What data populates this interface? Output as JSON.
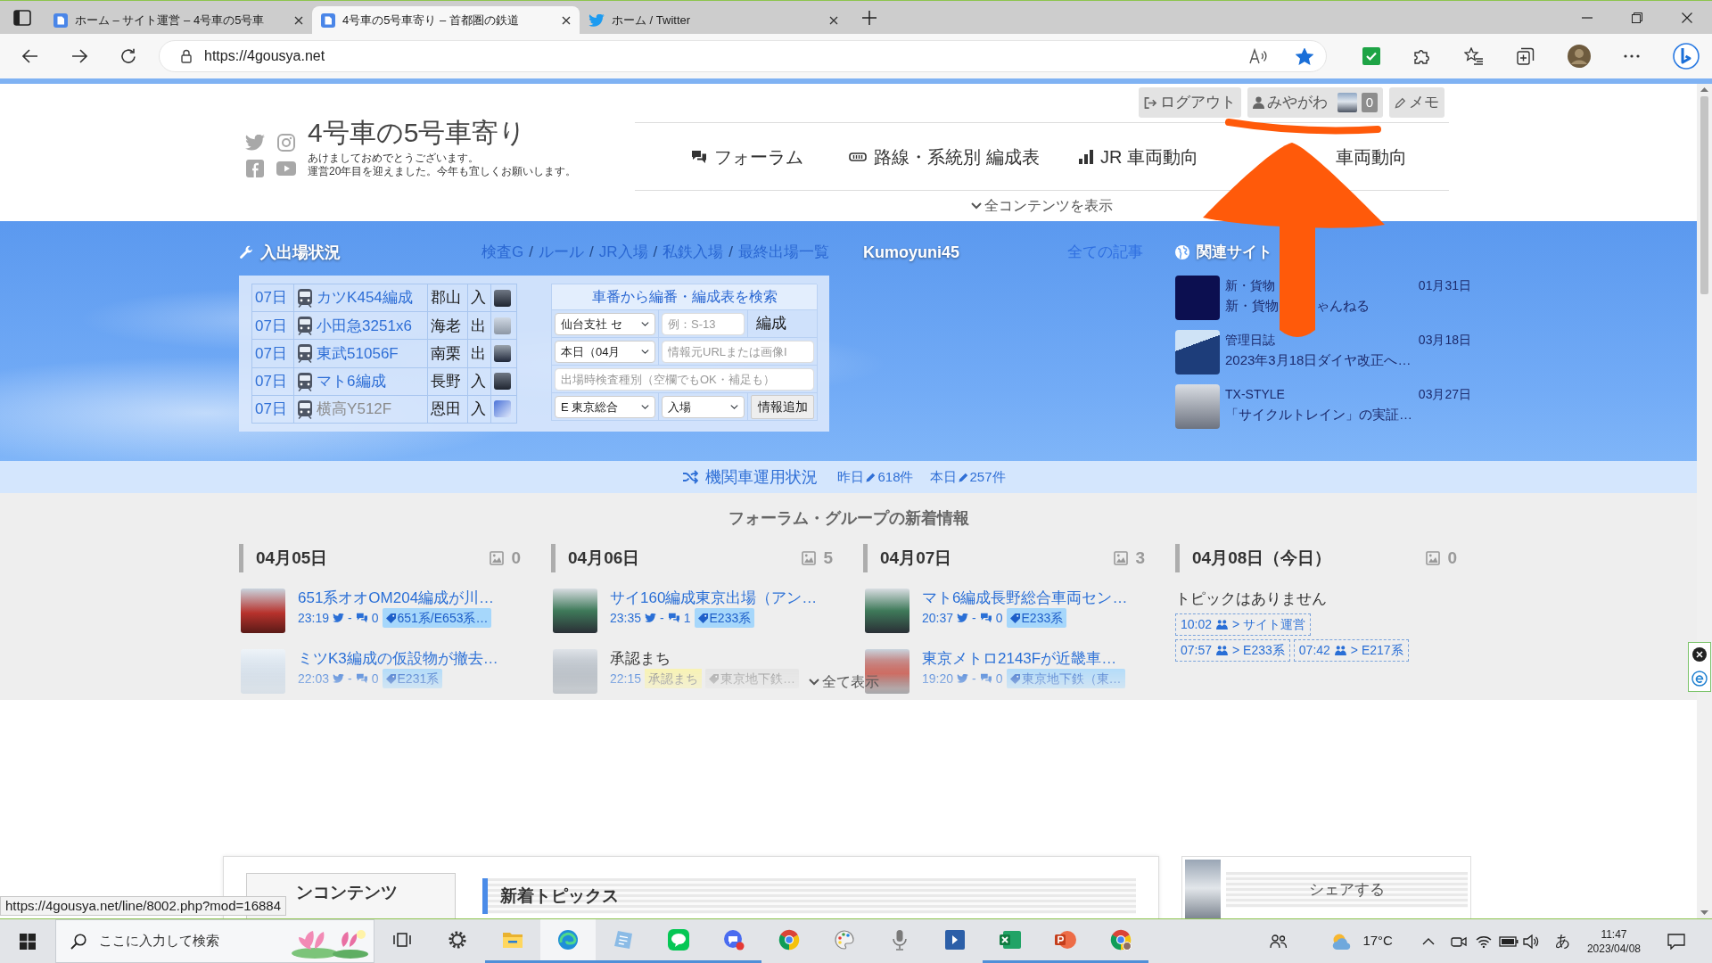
{
  "browser": {
    "tabs": [
      {
        "kind": "site",
        "title": "ホーム – サイト運営 – 4号車の5号車",
        "selected": false
      },
      {
        "kind": "site",
        "title": "4号車の5号車寄り – 首都圏の鉄道",
        "selected": true
      },
      {
        "kind": "twitter",
        "title": "ホーム / Twitter",
        "selected": false
      }
    ],
    "url": "https://4gousya.net",
    "bookmarked": true
  },
  "header": {
    "site_title": "4号車の5号車寄り",
    "tagline": [
      "あけましておめでとうございます。",
      "運営20年目を迎えました。今年も宜しくお願いします。"
    ],
    "account_buttons": [
      {
        "kind": "logout",
        "label": "ログアウト"
      },
      {
        "kind": "user",
        "label": "みやがわ",
        "count": "0"
      },
      {
        "kind": "memo",
        "label": "メモ"
      }
    ],
    "nav": [
      {
        "kind": "forum",
        "label": "フォーラム"
      },
      {
        "kind": "formation",
        "label": "路線・系統別 編成表"
      },
      {
        "kind": "chart",
        "label": "JR 車両動向"
      },
      {
        "kind": "plain",
        "label": "車両動向"
      }
    ],
    "show_all": "全コンテンツを表示"
  },
  "depot": {
    "title": "入出場状況",
    "links": [
      "検査G",
      "ルール",
      "JR入場",
      "私鉄入場",
      "最終出場一覧"
    ],
    "separator": "/",
    "rows": [
      {
        "day": "07日",
        "train": "カツK454編成",
        "place": "郡山",
        "direction": "入",
        "muted": false
      },
      {
        "day": "07日",
        "train": "小田急3251x6",
        "place": "海老",
        "direction": "出",
        "muted": false
      },
      {
        "day": "07日",
        "train": "東武51056F",
        "place": "南栗",
        "direction": "出",
        "muted": false
      },
      {
        "day": "07日",
        "train": "マト6編成",
        "place": "長野",
        "direction": "入",
        "muted": false
      },
      {
        "day": "07日",
        "train": "横高Y512F",
        "place": "恩田",
        "direction": "入",
        "muted": true
      }
    ],
    "search": {
      "title": "車番から編番・編成表を検索",
      "branch": "仙台支社 セ",
      "number_placeholder": "例：S-13",
      "unit": "編成",
      "date": "本日（04月",
      "source_placeholder": "情報元URLまたは画像I",
      "inspection_placeholder": "出場時検査種別（空欄でもOK・補足も）",
      "works": "E 東京総合",
      "event": "入場",
      "submit": "情報追加"
    }
  },
  "blog": {
    "author": "Kumoyuni45",
    "all_link": "全ての記事"
  },
  "related": {
    "title": "関連サイト",
    "items": [
      {
        "category": "新・貨物",
        "date": "01月31日",
        "title_parts": [
          "新・貨物",
          "ゃんねる"
        ]
      },
      {
        "category": "管理日誌",
        "date": "03月18日",
        "title_parts": [
          "2023年3月18日ダイヤ改正へ…"
        ]
      },
      {
        "category": "TX-STYLE",
        "date": "03月27日",
        "title_parts": [
          "「サイクルトレイン」の実証…"
        ]
      }
    ]
  },
  "loco": {
    "link": "機関車運用状況",
    "stats": [
      {
        "label": "昨日",
        "count": "618件"
      },
      {
        "label": "本日",
        "count": "257件"
      }
    ]
  },
  "forum": {
    "title": "フォーラム・グループの新着情報",
    "columns": [
      {
        "date": "04月05日",
        "image_count": "0",
        "posts": [
          {
            "kind": "topic",
            "title": "651系オオOM204編成が川…",
            "time": "23:19",
            "tweets": "-",
            "comments": "0",
            "tag": "651系/E653系…"
          },
          {
            "kind": "topic",
            "title": "ミツK3編成の仮設物が撤去…",
            "time": "22:03",
            "tweets": "-",
            "comments": "0",
            "tag": "E231系"
          }
        ]
      },
      {
        "date": "04月06日",
        "image_count": "5",
        "posts": [
          {
            "kind": "topic",
            "title": "サイ160編成東京出場（アン…",
            "time": "23:35",
            "tweets": "-",
            "comments": "1",
            "tag": "E233系"
          },
          {
            "kind": "pending",
            "title": "承認まち",
            "time": "22:15",
            "status": "承認まち",
            "tag": "東京地下鉄…"
          }
        ]
      },
      {
        "date": "04月07日",
        "image_count": "3",
        "posts": [
          {
            "kind": "topic",
            "title": "マト6編成長野総合車両セン…",
            "time": "20:37",
            "tweets": "-",
            "comments": "0",
            "tag": "E233系"
          },
          {
            "kind": "topic",
            "title": "東京メトロ2143Fが近畿車…",
            "time": "19:20",
            "tweets": "-",
            "comments": "0",
            "tag": "東京地下鉄（東…"
          }
        ]
      },
      {
        "date": "04月08日（今日）",
        "image_count": "0",
        "empty_text": "トピックはありません",
        "activity_rows": [
          [
            {
              "time": "10:02",
              "label": "> サイト運営"
            }
          ],
          [
            {
              "time": "07:57",
              "label": "> E233系"
            },
            {
              "time": "07:42",
              "label": "> E217系"
            }
          ]
        ]
      }
    ],
    "show_all": "全て表示"
  },
  "bottom": {
    "menu_title": "ンコンテンツ",
    "topics_title": "新着トピックス",
    "share_label": "シェアする"
  },
  "status_url": "https://4gousya.net/line/8002.php?mod=16884",
  "taskbar": {
    "search_placeholder": "ここに入力して検索",
    "apps": [
      {
        "kind": "taskview",
        "running": false,
        "active": false
      },
      {
        "kind": "settings",
        "running": false,
        "active": false
      },
      {
        "kind": "explorer",
        "running": true,
        "active": false
      },
      {
        "kind": "edge",
        "running": true,
        "active": true
      },
      {
        "kind": "notes",
        "running": true,
        "active": false
      },
      {
        "kind": "line",
        "running": true,
        "active": false
      },
      {
        "kind": "chat",
        "running": true,
        "active": false
      },
      {
        "kind": "chrome",
        "running": false,
        "active": false
      },
      {
        "kind": "paint",
        "running": false,
        "active": false
      },
      {
        "kind": "mic",
        "running": false,
        "active": false
      },
      {
        "kind": "remote",
        "running": false,
        "active": false
      },
      {
        "kind": "excel",
        "running": true,
        "active": false
      },
      {
        "kind": "powerpoint",
        "running": true,
        "active": false
      },
      {
        "kind": "chrome-profile",
        "running": true,
        "active": false
      }
    ],
    "temperature": "17°C",
    "ime": "あ",
    "time": "11:47",
    "date": "2023/04/08"
  }
}
